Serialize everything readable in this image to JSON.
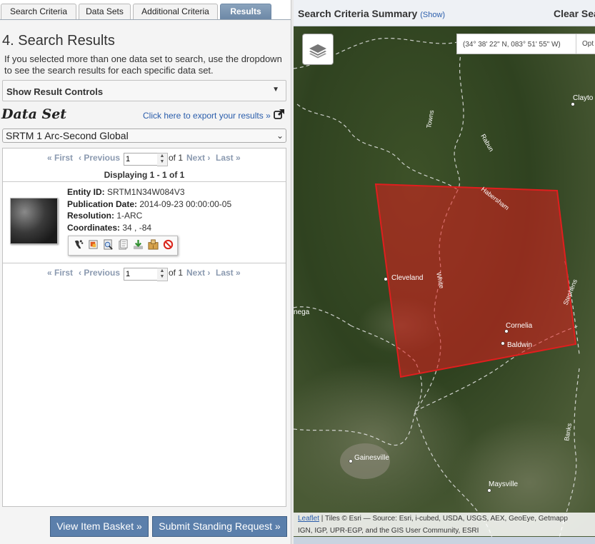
{
  "tabs": [
    "Search Criteria",
    "Data Sets",
    "Additional Criteria",
    "Results"
  ],
  "active_tab": "Results",
  "page_title": "4. Search Results",
  "intro_text": "If you selected more than one data set to search, use the dropdown to see the search results for each specific data set.",
  "controls_label": "Show Result Controls",
  "dataset_heading": "Data Set",
  "export_link": "Click here to export your results »",
  "dataset_selected": "SRTM 1 Arc-Second Global",
  "pager": {
    "first": "« First",
    "previous": "‹ Previous",
    "page": "1",
    "of": "of 1",
    "next": "Next ›",
    "last": "Last »"
  },
  "displaying": "Displaying 1 - 1 of 1",
  "result": {
    "entity_label": "Entity ID:",
    "entity_value": "SRTM1N34W084V3",
    "pubdate_label": "Publication Date:",
    "pubdate_value": "2014-09-23 00:00:00-05",
    "resolution_label": "Resolution:",
    "resolution_value": "1-ARC",
    "coordinates_label": "Coordinates:",
    "coordinates_value": "34 , -84",
    "tool_icons": [
      "footprint-icon",
      "overlay-icon",
      "metadata-icon",
      "compare-icon",
      "download-icon",
      "order-icon",
      "exclude-icon"
    ]
  },
  "buttons": {
    "basket": "View Item Basket »",
    "standing": "Submit Standing Request »"
  },
  "map": {
    "summary_title": "Search Criteria Summary",
    "summary_show": "(Show)",
    "clear_label": "Clear Sea",
    "coordinates": "(34° 38' 22\" N, 083° 51' 55\" W)",
    "options_label": "Opt",
    "attribution_link": "Leaflet",
    "attribution_line1": " | Tiles © Esri — Source: Esri, i-cubed, USDA, USGS, AEX, GeoEye, Getmapp",
    "attribution_line2": "IGN, IGP, UPR-EGP, and the GIS User Community, ESRI",
    "places": [
      "Clayto",
      "Towns",
      "Rabun",
      "Habersham",
      "Cleveland",
      "White",
      "Stephens",
      "Cornelia",
      "Baldwin",
      "nega",
      "Gainesville",
      "Maysville",
      "Banks"
    ],
    "footprint_color": "#e01e1e"
  }
}
